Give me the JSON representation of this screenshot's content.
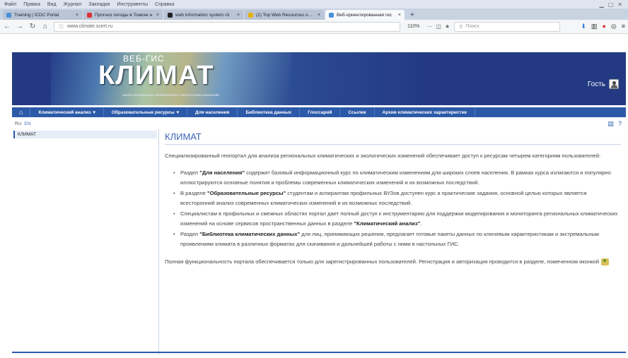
{
  "browser": {
    "menu_items": [
      "Файл",
      "Правка",
      "Вид",
      "Журнал",
      "Закладки",
      "Инструменты",
      "Справка"
    ],
    "tabs": [
      {
        "label": "Training | ICDC Portal",
        "icon": "doc-icon",
        "active": false
      },
      {
        "label": "Прогноз погоды в Томске н",
        "icon": "weather-icon",
        "active": false
      },
      {
        "label": "web information system cli",
        "icon": "globe-icon",
        "active": false
      },
      {
        "label": "(2) Top Web Resources on C",
        "icon": "bookmark-icon",
        "active": false
      },
      {
        "label": "Веб-ориентированная гис",
        "icon": "globe-icon",
        "active": true
      }
    ],
    "new_tab": "+",
    "url": "www.climate.scert.ru",
    "zoom": "110%",
    "search_placeholder": "Поиск",
    "accent": "#2f7be0"
  },
  "header": {
    "logo_sub": "ВЕБ-ГИС",
    "logo_main": "КЛИМАТ",
    "logo_tagline": "анализ региональных климатических и экологических изменений",
    "guest_label": "Гость"
  },
  "menu": {
    "items": [
      {
        "label": "Климатический анализ",
        "dropdown": true
      },
      {
        "label": "Образовательные ресурсы",
        "dropdown": true
      },
      {
        "label": "Для населения",
        "dropdown": false
      },
      {
        "label": "Библиотека данных",
        "dropdown": false
      },
      {
        "label": "Глоссарий",
        "dropdown": false
      },
      {
        "label": "Ссылки",
        "dropdown": false
      },
      {
        "label": "Архив климатических характеристик",
        "dropdown": false
      }
    ],
    "color": "#2c5aa8"
  },
  "crumbs": {
    "lang_ru": "RU",
    "lang_en": "EN"
  },
  "sidebar": {
    "items": [
      "КЛИМАТ"
    ]
  },
  "content": {
    "title": "КЛИМАТ",
    "intro": "Специализированный геопортал для анализа региональных климатических и экологических изменений обеспечивает доступ к ресурсам четырем категориям пользователей:",
    "bullets": [
      {
        "pre": "Раздел ",
        "bold": "\"Для населения\"",
        "post": " содержит базовый информационный курс по климатическим изменениям для широких слоев населения. В рамках курса излагаются и популярно иллюстрируются основные понятия и проблемы современных климатических изменений и их возможных последствий."
      },
      {
        "pre": "В разделе ",
        "bold": "\"Образовательные ресурсы\"",
        "post": " студентам и аспирантам профильных ВУЗов доступен курс и практические задания, основной целью которых является всесторонний анализ современных климатических изменений и их возможных последствий."
      },
      {
        "pre": "Специалистам в профильных и смежных областях портал дает полный доступ к инструментарию для поддержки моделирования и мониторинга региональных климатических изменений на основе сервисов пространственных данных в разделе ",
        "bold": "\"Климатический анализ\"",
        "post": "."
      },
      {
        "pre": "Раздел ",
        "bold": "\"Библиотека климатических данных\"",
        "post": " для лиц, принимающих решения, предлагает готовые пакеты данных по ключевым характеристикам и экстремальным проявлениям климата в различных форматах для скачивания и дальнейшей работы с ними в настольных ГИС."
      }
    ],
    "footer": "Полная функциональность портала обеспечивается только для зарегистрированных пользователей. Регистрация и авторизация проводится в разделе, помеченном иконкой"
  }
}
